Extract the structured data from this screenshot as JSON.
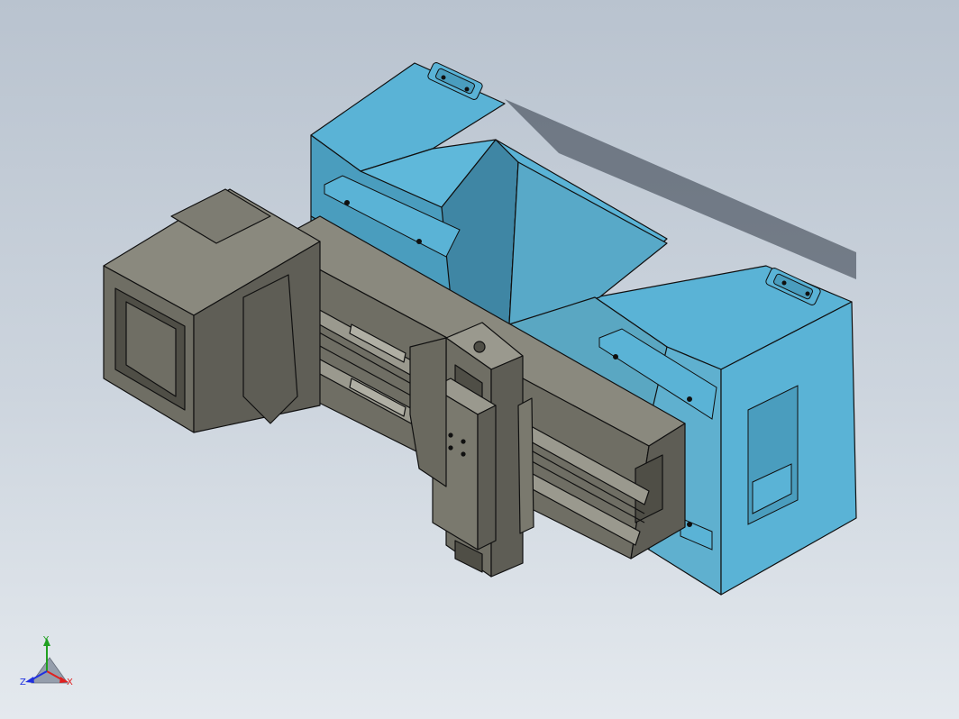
{
  "viewport": {
    "background_top": "#b9c3cf",
    "background_bottom": "#e4e9ee"
  },
  "model": {
    "base_color": "#5ab3d6",
    "base_shade": "#468fab",
    "column_color": "#6f6e64",
    "column_light": "#8a897e",
    "column_dark": "#4f4e46",
    "edge_color": "#101010"
  },
  "triad": {
    "x_label": "X",
    "y_label": "Y",
    "z_label": "Z",
    "x_color": "#e02020",
    "y_color": "#20a020",
    "z_color": "#2030e0"
  }
}
